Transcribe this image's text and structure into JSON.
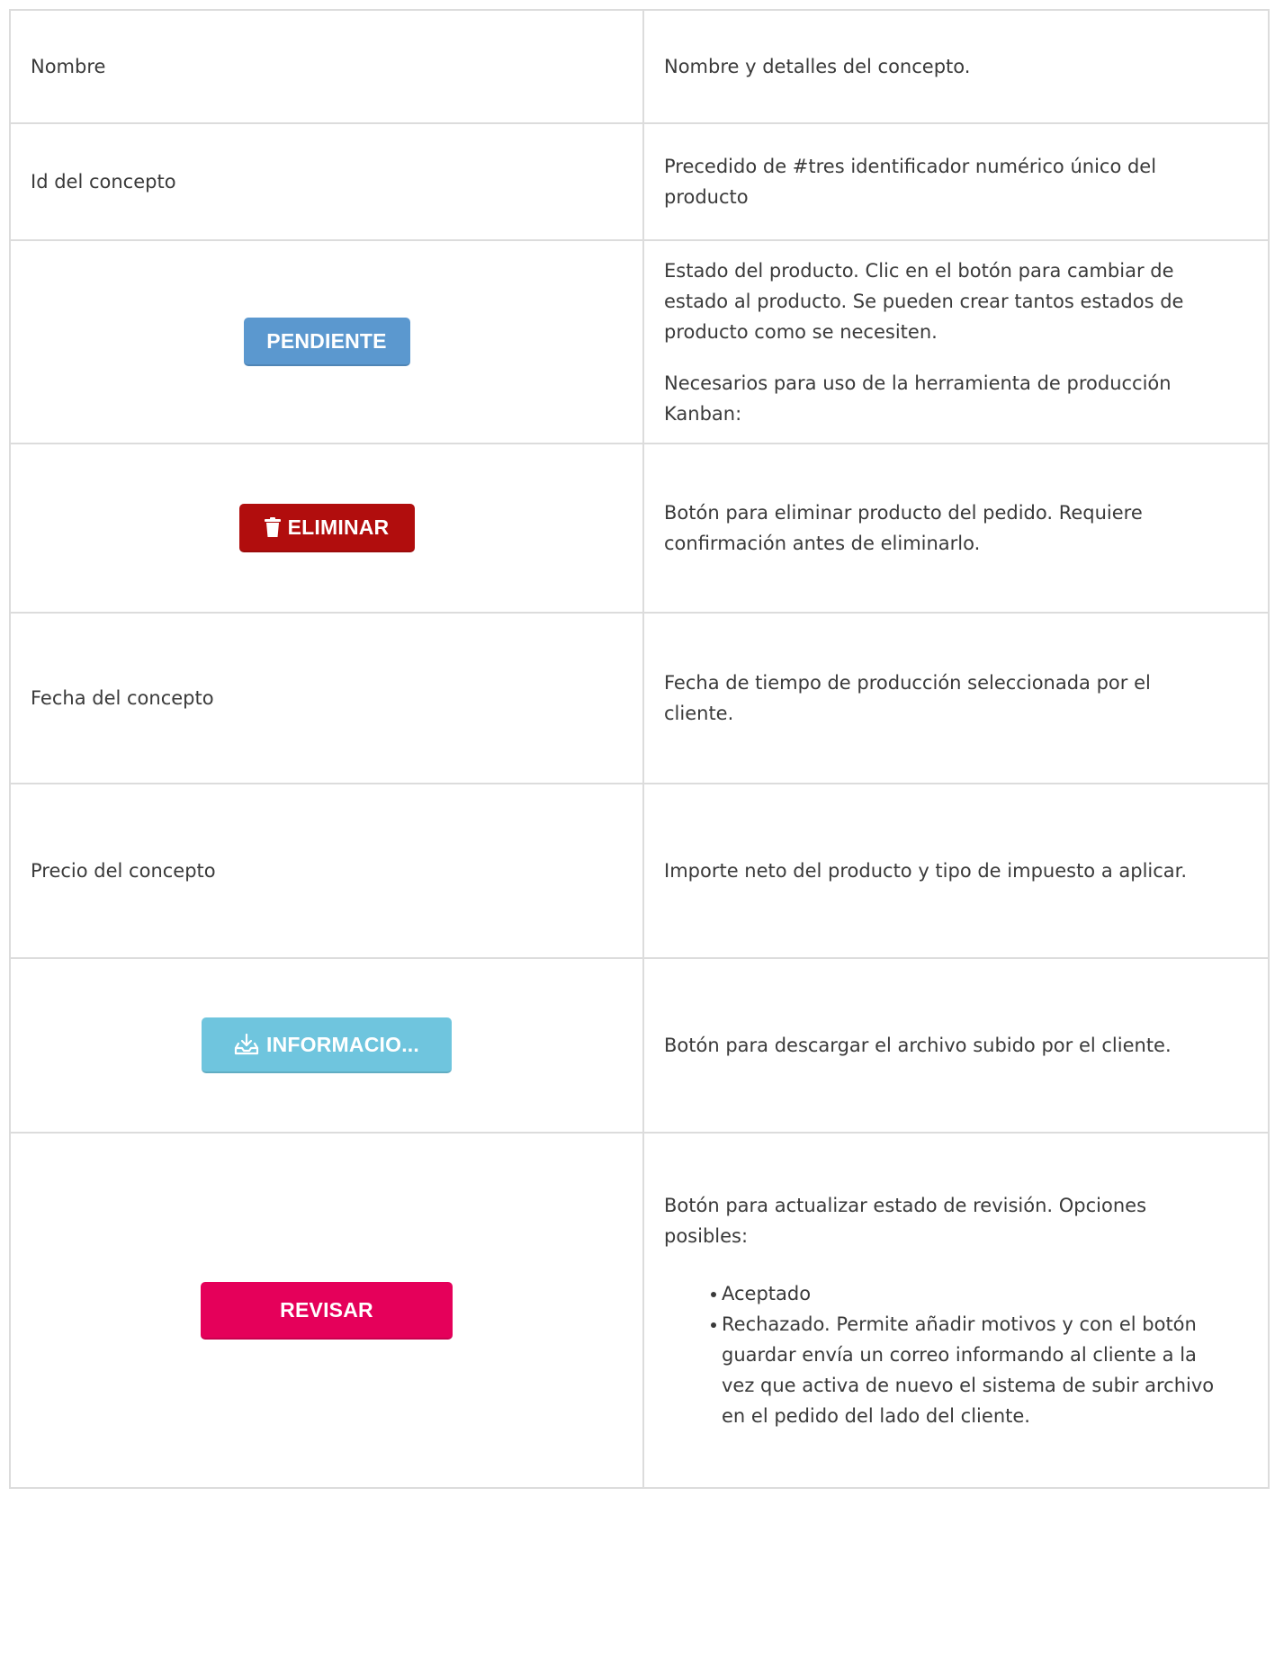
{
  "rows": [
    {
      "label": "Nombre",
      "description": [
        "Nombre y detalles del concepto."
      ]
    },
    {
      "label": "Id del concepto",
      "description": [
        "Precedido de #tres identificador numérico único del producto"
      ]
    },
    {
      "button": "PENDIENTE",
      "description": [
        "Estado del producto. Clic en el botón para cambiar de estado al producto. Se pueden crear tantos estados de producto como se necesiten.",
        "Necesarios para uso de la herramienta de producción Kanban:"
      ]
    },
    {
      "button": "ELIMINAR",
      "icon": "trash-icon",
      "description": [
        "Botón para eliminar producto del pedido. Requiere confirmación antes de eliminarlo."
      ]
    },
    {
      "label": "Fecha del concepto",
      "description": [
        "Fecha de tiempo de producción seleccionada por el cliente."
      ]
    },
    {
      "label": "Precio del concepto",
      "description": [
        "Importe neto del producto y tipo de impuesto a aplicar."
      ]
    },
    {
      "button": "INFORMACIO...",
      "icon": "download-tray-icon",
      "description": [
        "Botón para descargar el archivo subido por el cliente."
      ]
    },
    {
      "button": "REVISAR",
      "description": [
        "Botón para actualizar estado de revisión. Opciones posibles:"
      ],
      "options": [
        "Aceptado",
        "Rechazado. Permite añadir motivos y con el botón guardar envía  un correo informando al cliente  a la vez que activa de nuevo el sistema de subir archivo en el pedido del lado del cliente."
      ]
    }
  ],
  "colors": {
    "pendiente": "#5b98cf",
    "eliminar": "#b10d0d",
    "informacion": "#6fc5de",
    "revisar": "#e5005a",
    "border": "#dcdcdc",
    "text": "#3a3a3a"
  }
}
